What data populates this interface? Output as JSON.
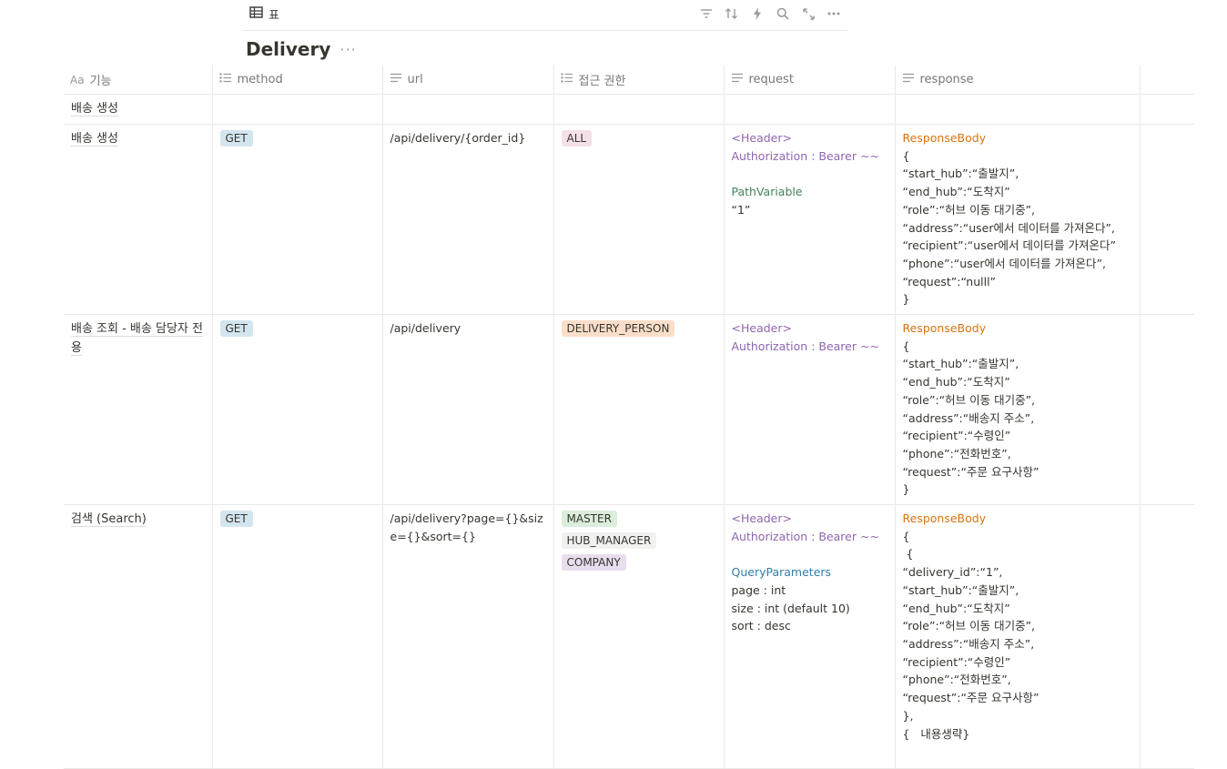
{
  "view": {
    "tab_label": "표"
  },
  "database": {
    "title": "Delivery"
  },
  "columns": [
    {
      "label": "기능",
      "icon": "title-icon"
    },
    {
      "label": "method",
      "icon": "list-icon"
    },
    {
      "label": "url",
      "icon": "text-icon"
    },
    {
      "label": "접근 권한",
      "icon": "list-icon"
    },
    {
      "label": "request",
      "icon": "text-icon"
    },
    {
      "label": "response",
      "icon": "text-icon"
    }
  ],
  "rows": [
    {
      "name": "배송 생성"
    },
    {
      "name": "배송 생성",
      "method": "GET",
      "url": "/api/delivery/{order_id}",
      "access": [
        "ALL"
      ],
      "request": [
        "<Header>",
        "Authorization : Bearer ~~",
        "",
        "PathVariable",
        "“1”"
      ],
      "response": [
        "ResponseBody",
        "{",
        "“start_hub”:“출발지”,",
        "“end_hub”:“도착지”",
        "“role”:“허브 이동 대기중”,",
        "“address”:“user에서 데이터를 가져온다”,",
        "“recipient”:“user에서 데이터를 가져온다”",
        "“phone”:“user에서 데이터를 가져온다”,",
        "“request”:“nulll”",
        "}"
      ]
    },
    {
      "name": "배송 조회 - 배송 담당자 전용",
      "method": "GET",
      "url": "/api/delivery",
      "access": [
        "DELIVERY_PERSON"
      ],
      "request": [
        "<Header>",
        "Authorization : Bearer ~~"
      ],
      "response": [
        "ResponseBody",
        "{",
        "“start_hub”:“출발지”,",
        "“end_hub”:“도착지”",
        "“role”:“허브 이동 대기중”,",
        "“address”:“배송지 주소”,",
        "“recipient”:“수령인”",
        "“phone”:“전화번호”,",
        "“request”:“주문 요구사항”",
        "}"
      ]
    },
    {
      "name": "검색 (Search)",
      "method": "GET",
      "url": "/api/delivery?page={}&size={}&sort={}",
      "access": [
        "MASTER",
        "HUB_MANAGER",
        "COMPANY"
      ],
      "request": [
        "<Header>",
        "Authorization : Bearer ~~",
        "",
        "QueryParameters",
        "page : int",
        "size : int (default 10)",
        "sort : desc"
      ],
      "response": [
        "ResponseBody",
        "{",
        " {",
        "“delivery_id”:“1”,",
        "“start_hub”:“출발지”,",
        "“end_hub”:“도착지”",
        "“role”:“허브 이동 대기중”,",
        "“address”:“배송지 주소”,",
        "“recipient”:“수령인”",
        "“phone”:“전화번호”,",
        "“request”:“주문 요구사항”",
        "},",
        "{   내용생략}"
      ]
    }
  ],
  "colors": {
    "get": "#d3e5ef",
    "all": "#f5e0e9",
    "delivery_person": "#fadec9",
    "master": "#dbeddb",
    "hub_manager": "#f1f1ef",
    "company": "#e8deee",
    "header_purple": "#9065b0",
    "query_blue": "#337ea9",
    "response_orange": "#d9730d"
  }
}
